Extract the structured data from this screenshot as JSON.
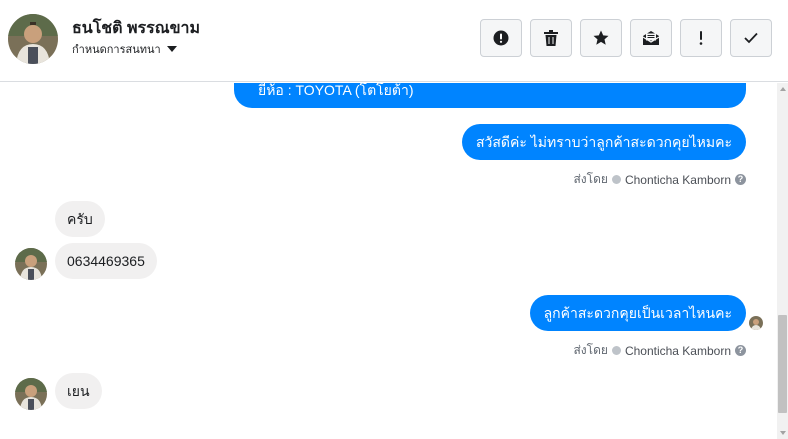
{
  "header": {
    "contact_name": "ธนโชติ พรรณขาม",
    "label_menu": "กำหนดการสนทนา",
    "actions": [
      {
        "name": "spam-button",
        "icon": "alert-circle-icon"
      },
      {
        "name": "delete-button",
        "icon": "trash-icon"
      },
      {
        "name": "star-button",
        "icon": "star-icon"
      },
      {
        "name": "mark-unread-button",
        "icon": "envelope-icon"
      },
      {
        "name": "follow-up-button",
        "icon": "exclamation-icon"
      },
      {
        "name": "mark-done-button",
        "icon": "checkmark-icon"
      }
    ]
  },
  "messages": [
    {
      "direction": "outgoing",
      "text": "ยี่ห้อ : TOYOTA (โตโยต้า)"
    },
    {
      "direction": "outgoing",
      "text": "สวัสดีค่ะ ไม่ทราบว่าลูกค้าสะดวกคุยไหมคะ",
      "sent_by_prefix": "ส่งโดย",
      "agent": "Chonticha Kamborn"
    },
    {
      "direction": "incoming",
      "text": "ครับ"
    },
    {
      "direction": "incoming",
      "text": "0634469365"
    },
    {
      "direction": "outgoing",
      "text": "ลูกค้าสะดวกคุยเป็นเวลาไหนคะ",
      "sent_by_prefix": "ส่งโดย",
      "agent": "Chonticha Kamborn"
    },
    {
      "direction": "incoming",
      "text": "เยน"
    }
  ],
  "colors": {
    "outgoing_bubble": "#0084ff",
    "incoming_bubble": "#f1f0f0",
    "header_border": "#dadde1"
  }
}
